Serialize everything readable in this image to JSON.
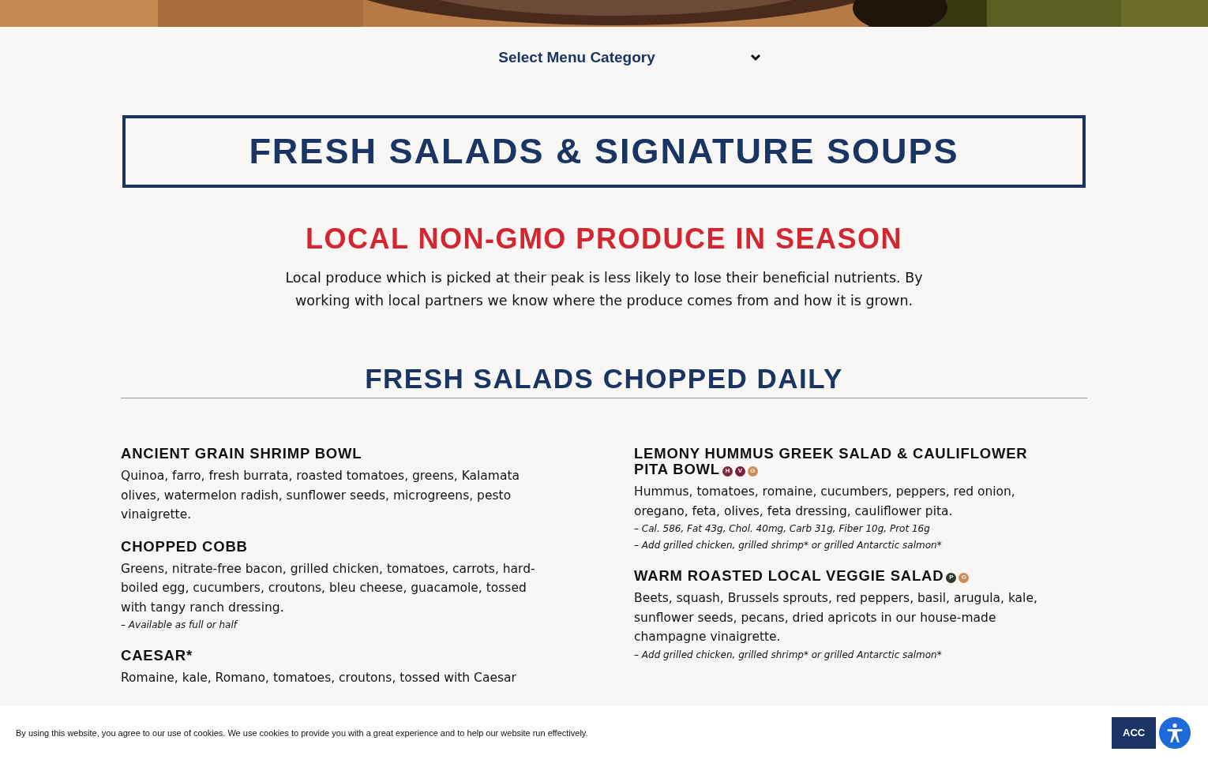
{
  "category_select": {
    "label": "Select Menu Category"
  },
  "section_title": "FRESH SALADS & SIGNATURE SOUPS",
  "feature": {
    "heading": "LOCAL NON-GMO PRODUCE IN SEASON",
    "text": "Local produce which is picked at their peak is less likely to lose their beneficial nutrients. By working with local partners we know where the produce comes from and how it is grown."
  },
  "subsection_title": "FRESH SALADS CHOPPED DAILY",
  "columns": [
    {
      "items": [
        {
          "name": "ANCIENT GRAIN SHRIMP BOWL",
          "description": "Quinoa, farro, fresh burrata, roasted tomatoes, greens, Kalamata olives, watermelon radish, sunflower seeds, microgreens, pesto vinaigrette."
        },
        {
          "name": "CHOPPED COBB",
          "description": "Greens, nitrate-free bacon, grilled chicken, tomatoes, carrots, hard-boiled egg, cucumbers, croutons, bleu cheese, guacamole, tossed with tangy ranch dressing.",
          "notes": [
            "– Available as full or half"
          ]
        },
        {
          "name": "CAESAR*",
          "description": "Romaine, kale, Romano, tomatoes, croutons, tossed with Caesar"
        }
      ]
    },
    {
      "items": [
        {
          "name": "LEMONY HUMMUS GREEK SALAD & CAULIFLOWER PITA BOWL",
          "badges": [
            {
              "letter": "H",
              "color": "#7d2a3a"
            },
            {
              "letter": "V",
              "color": "#7a1e3c"
            },
            {
              "letter": "G",
              "color": "#d08a55"
            }
          ],
          "description": "Hummus, tomatoes, romaine, cucumbers, peppers, red onion, oregano, feta, olives, feta dressing, cauliflower pita.",
          "notes": [
            "– Cal. 586, Fat 43g, Chol. 40mg, Carb 31g, Fiber 10g, Prot 16g",
            "– Add grilled chicken, grilled shrimp* or grilled Antarctic salmon*"
          ]
        },
        {
          "name": "WARM ROASTED LOCAL VEGGIE SALAD",
          "badges": [
            {
              "letter": "P",
              "color": "#2f3a2c"
            },
            {
              "letter": "G",
              "color": "#d08a55"
            }
          ],
          "description": "Beets, squash, Brussels sprouts, red peppers, basil, arugula, kale, sunflower seeds, pecans, dried apricots in our house-made champagne vinaigrette.",
          "notes": [
            "– Add grilled chicken, grilled shrimp* or grilled Antarctic salmon*"
          ]
        }
      ]
    }
  ],
  "cookie_banner": {
    "text": "By using this website, you agree to our use of cookies. We use cookies to provide you with a great experience and to help our website run effectively.",
    "button": "ACC"
  }
}
